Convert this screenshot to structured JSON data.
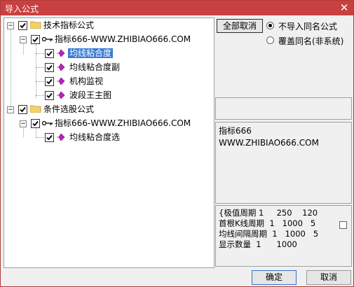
{
  "window": {
    "title": "导入公式",
    "close_glyph": "✕"
  },
  "tree": {
    "group1": {
      "label": "技术指标公式",
      "child": {
        "label": "指标666-WWW.ZHIBIAO666.COM",
        "items": [
          "均线粘合度",
          "均线粘合度副",
          "机构监视",
          "波段王主图"
        ]
      }
    },
    "group2": {
      "label": "条件选股公式",
      "child": {
        "label": "指标666-WWW.ZHIBIAO666.COM",
        "items": [
          "均线粘合度选"
        ]
      }
    }
  },
  "controls": {
    "select_all_label": "全部取消",
    "radio_skip_label": "不导入同名公式",
    "radio_overwrite_label": "覆盖同名(非系统)"
  },
  "description": {
    "line1": "指标666",
    "line2": "WWW.ZHIBIAO666.COM"
  },
  "params": {
    "line1": "{极值周期 1     250    120",
    "line2": "首根K线周期  1   1000   5",
    "line3": "均线间隔周期  1   1000   5",
    "line4": "显示数量  1      1000"
  },
  "footer": {
    "ok_label": "确定",
    "cancel_label": "取消"
  }
}
